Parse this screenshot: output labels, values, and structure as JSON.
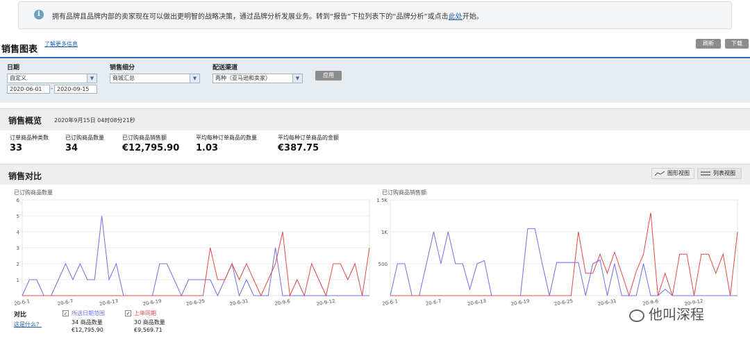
{
  "banner": {
    "text": "拥有品牌且品牌内部的卖家现在可以做出更明智的战略决策，通过品牌分析发展业务。转到“报告”下拉列表下的“品牌分析”或点击",
    "link": "此处",
    "tail": "开始。"
  },
  "header": {
    "title": "销售图表",
    "learn_more": "了解更多信息",
    "refresh": "刷新",
    "download": "下载"
  },
  "filters": {
    "date_label": "日期",
    "date_value": "自定义",
    "date_from": "2020-06-01",
    "date_sep": "-",
    "date_to": "2020-09-15",
    "breakdown_label": "销售细分",
    "breakdown_value": "商城汇总",
    "channel_label": "配送渠道",
    "channel_value": "两种（亚马逊和卖家）",
    "apply": "应用"
  },
  "overview": {
    "title": "销售概览",
    "timestamp": "2020年9月15日 04时08分21秒",
    "metrics": [
      {
        "label": "订单商品种类数",
        "value": "33"
      },
      {
        "label": "已订购商品数量",
        "value": "34"
      },
      {
        "label": "已订购商品销售额",
        "value": "€12,795.90"
      },
      {
        "label": "平均每种订单商品的数量",
        "value": "1.03"
      },
      {
        "label": "平均每种订单商品的金额",
        "value": "€387.75"
      }
    ]
  },
  "compare": {
    "title": "销售对比",
    "graph_view": "图形视图",
    "table_view": "列表视图",
    "label": "对比",
    "what": "这是什么？",
    "sel": {
      "label": "所选日期范围",
      "qty": "34 商品数量",
      "amt": "€12,795.90"
    },
    "prev": {
      "label": "上年同期",
      "qty": "30 商品数量",
      "amt": "€9,569.71"
    }
  },
  "colors": {
    "selected": "#6f6fe8",
    "previous": "#e04848",
    "accent": "#2f6db2"
  },
  "watermark": "他叫深程",
  "chart_data": [
    {
      "type": "line",
      "title": "已订购商品数量",
      "ylim": [
        0,
        6
      ],
      "yticks": [
        "1",
        "2",
        "3",
        "4",
        "5",
        "6"
      ],
      "xticks": [
        "20-6-1",
        "20-6-7",
        "20-6-13",
        "20-6-19",
        "20-6-25",
        "20-6-31",
        "20-9-6",
        "20-9-12"
      ],
      "series": [
        {
          "name": "所选日期范围",
          "values": [
            0,
            1,
            1,
            0,
            0,
            1,
            2,
            1,
            2,
            1,
            1,
            5,
            1,
            2,
            0,
            0,
            0,
            0,
            0,
            2,
            2,
            1,
            0,
            1,
            1,
            1,
            1,
            0,
            1,
            2,
            0,
            1,
            0,
            0,
            0,
            3,
            0,
            0,
            0,
            0,
            0,
            0,
            0,
            0,
            0,
            0,
            0,
            0,
            0
          ]
        },
        {
          "name": "上年同期",
          "values": [
            0,
            0,
            0,
            0,
            0,
            0,
            0,
            0,
            0,
            0,
            0,
            0,
            0,
            0,
            0,
            0,
            0,
            0,
            0,
            0,
            0,
            0,
            0,
            0,
            0,
            0,
            3,
            1,
            1,
            2,
            1,
            2,
            1,
            0,
            1,
            2,
            4,
            0,
            1,
            0,
            2,
            1,
            0,
            2,
            2,
            1,
            2,
            0,
            3
          ]
        }
      ]
    },
    {
      "type": "line",
      "title": "已订购商品销售额",
      "ylim": [
        0,
        1500
      ],
      "yticks": [
        "500",
        "1K",
        "1.5K"
      ],
      "xticks": [
        "20-6-1",
        "20-6-7",
        "20-6-13",
        "20-6-19",
        "20-6-25",
        "20-6-31",
        "20-9-6",
        "20-9-12"
      ],
      "series": [
        {
          "name": "所选日期范围",
          "values": [
            0,
            500,
            500,
            0,
            0,
            500,
            1000,
            500,
            1000,
            500,
            500,
            100,
            500,
            550,
            0,
            0,
            0,
            0,
            0,
            1050,
            1050,
            500,
            0,
            520,
            520,
            520,
            520,
            0,
            500,
            560,
            0,
            500,
            0,
            0,
            0,
            500,
            0,
            0,
            100,
            0,
            0,
            0,
            0,
            0,
            0,
            0,
            0,
            0,
            0
          ]
        },
        {
          "name": "上年同期",
          "values": [
            0,
            0,
            0,
            0,
            0,
            0,
            0,
            0,
            0,
            0,
            0,
            0,
            0,
            0,
            0,
            0,
            0,
            0,
            0,
            0,
            0,
            0,
            0,
            0,
            0,
            0,
            1000,
            350,
            350,
            650,
            350,
            680,
            350,
            0,
            380,
            650,
            1300,
            0,
            350,
            0,
            650,
            650,
            0,
            650,
            650,
            350,
            650,
            0,
            1000
          ]
        }
      ]
    }
  ]
}
